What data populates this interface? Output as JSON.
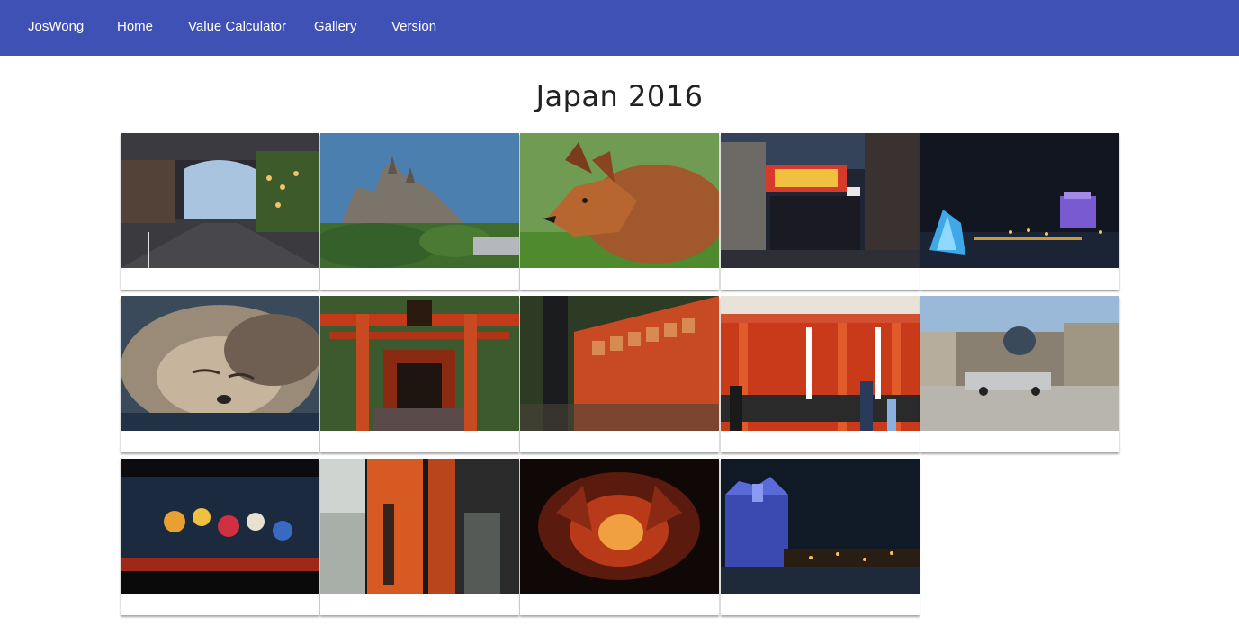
{
  "nav": {
    "brand": "JosWong",
    "links": [
      "Home",
      "Value Calculator",
      "Gallery",
      "Version"
    ]
  },
  "colors": {
    "navbar": "#3f51b5",
    "nav_text": "#ffffff",
    "title_text": "#222222"
  },
  "gallery": {
    "title": "Japan 2016",
    "photo_count": 14,
    "columns": 5
  }
}
